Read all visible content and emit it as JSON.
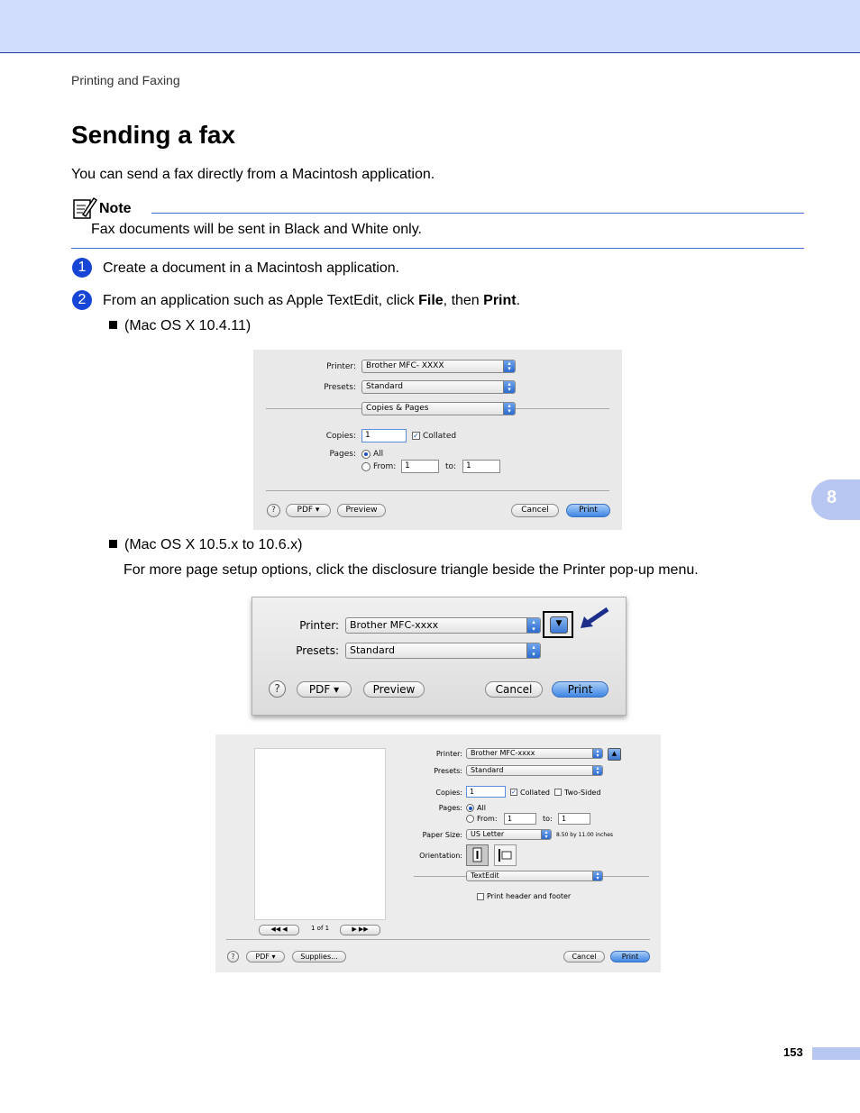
{
  "header": {
    "breadcrumb": "Printing and Faxing"
  },
  "title": "Sending a fax",
  "intro": "You can send a fax directly from a Macintosh application.",
  "note": {
    "label": "Note",
    "text": "Fax documents will be sent in Black and White only."
  },
  "steps": [
    {
      "num": "1",
      "text": "Create a document in a Macintosh application."
    },
    {
      "num": "2",
      "text_pre": "From an application such as Apple TextEdit, click ",
      "bold1": "File",
      "text_mid": ", then ",
      "bold2": "Print",
      "text_post": "."
    }
  ],
  "bullets": [
    {
      "text": "(Mac OS X 10.4.11)"
    },
    {
      "text": "(Mac OS X 10.5.x to 10.6.x)"
    }
  ],
  "para": "For more page setup options, click the disclosure triangle beside the Printer pop-up menu.",
  "side_tab": "8",
  "page_number": "153",
  "dialog1": {
    "printer_label": "Printer:",
    "printer_value": "Brother MFC- XXXX",
    "presets_label": "Presets:",
    "presets_value": "Standard",
    "panel_value": "Copies & Pages",
    "copies_label": "Copies:",
    "copies_value": "1",
    "collated_label": "Collated",
    "pages_label": "Pages:",
    "all_label": "All",
    "from_label": "From:",
    "from_value": "1",
    "to_label": "to:",
    "to_value": "1",
    "help": "?",
    "pdf": "PDF ▾",
    "preview": "Preview",
    "cancel": "Cancel",
    "print": "Print"
  },
  "dialog2": {
    "printer_label": "Printer:",
    "printer_value": "Brother MFC-xxxx",
    "presets_label": "Presets:",
    "presets_value": "Standard",
    "disclosure": "▼",
    "help": "?",
    "pdf": "PDF ▾",
    "preview": "Preview",
    "cancel": "Cancel",
    "print": "Print"
  },
  "dialog3": {
    "printer_label": "Printer:",
    "printer_value": "Brother MFC-xxxx",
    "presets_label": "Presets:",
    "presets_value": "Standard",
    "copies_label": "Copies:",
    "copies_value": "1",
    "collated_label": "Collated",
    "twosided_label": "Two-Sided",
    "pages_label": "Pages:",
    "all_label": "All",
    "from_label": "From:",
    "from_value": "1",
    "to_label": "to:",
    "to_value": "1",
    "papersize_label": "Paper Size:",
    "papersize_value": "US Letter",
    "papersize_dims": "8.50 by 11.00 inches",
    "orientation_label": "Orientation:",
    "panel_value": "TextEdit",
    "header_footer_label": "Print header and footer",
    "page_indicator": "1 of 1",
    "help": "?",
    "pdf": "PDF ▾",
    "supplies": "Supplies...",
    "cancel": "Cancel",
    "print": "Print"
  }
}
